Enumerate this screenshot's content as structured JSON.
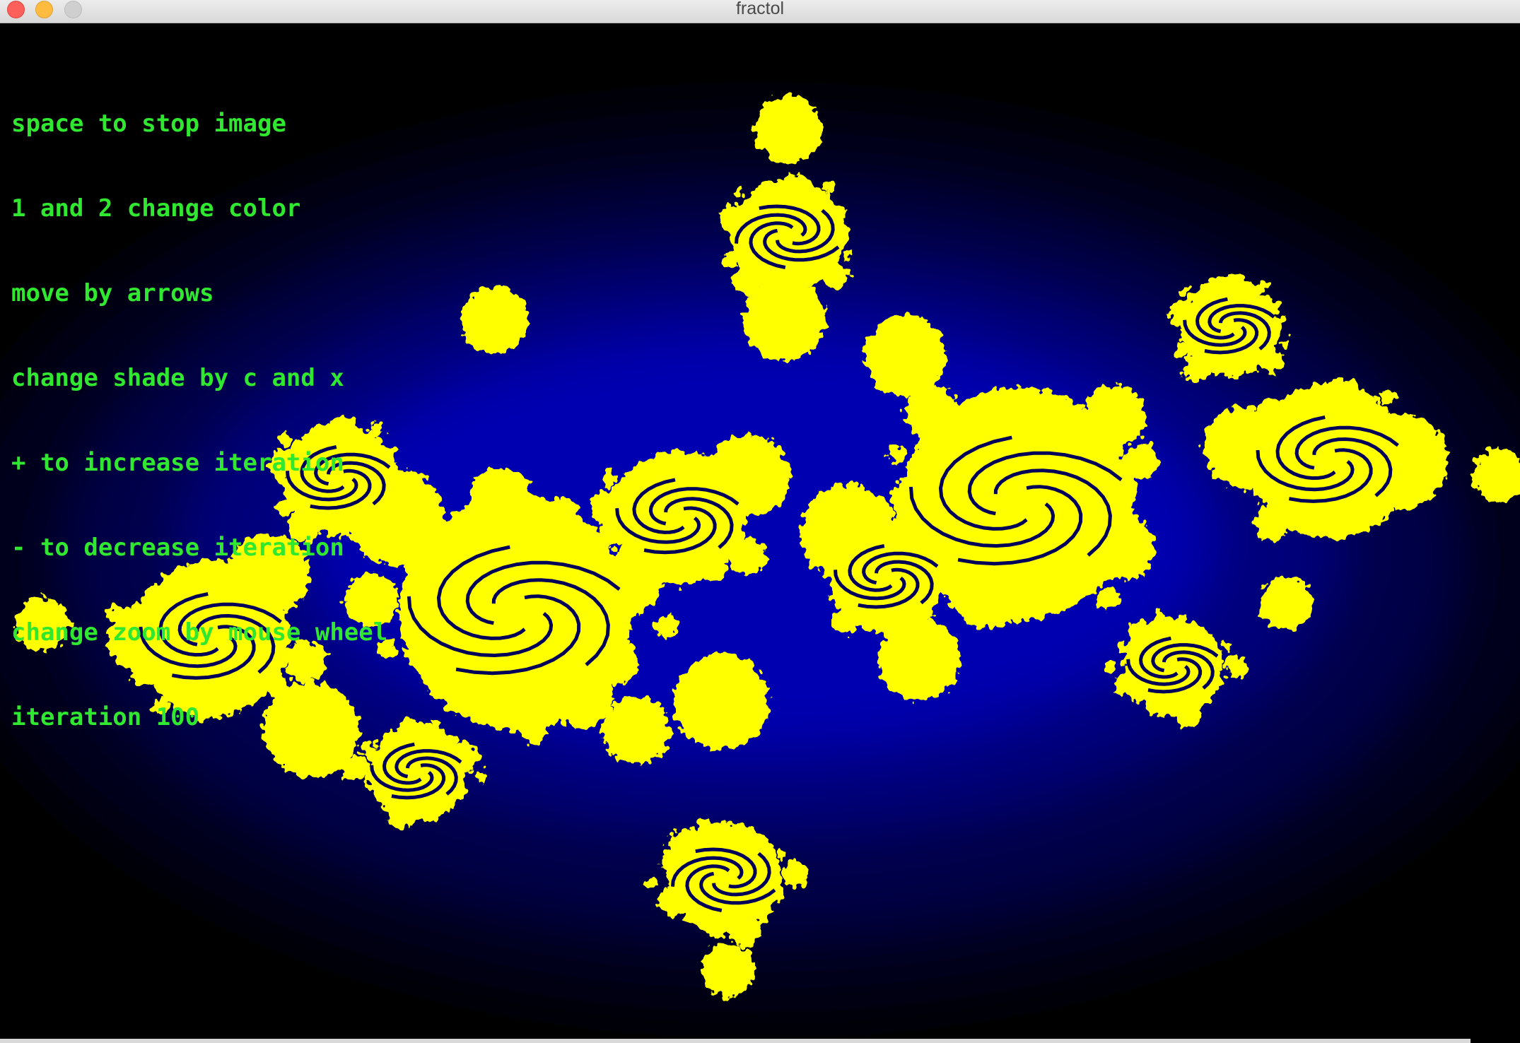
{
  "window": {
    "title": "fractol"
  },
  "overlay": {
    "lines": [
      "space to stop image",
      "1 and 2 change color",
      "move by arrows",
      "change shade by c and x",
      "+ to increase iteration",
      "- to decrease iteration",
      "change zoom by mouse wheel",
      "iteration 100"
    ],
    "text_color": "#2fe82f"
  },
  "fractal": {
    "type": "julia",
    "iteration": 100,
    "colors": {
      "interior": "#ffff00",
      "exterior": "#0000ff",
      "background": "#000000"
    }
  }
}
